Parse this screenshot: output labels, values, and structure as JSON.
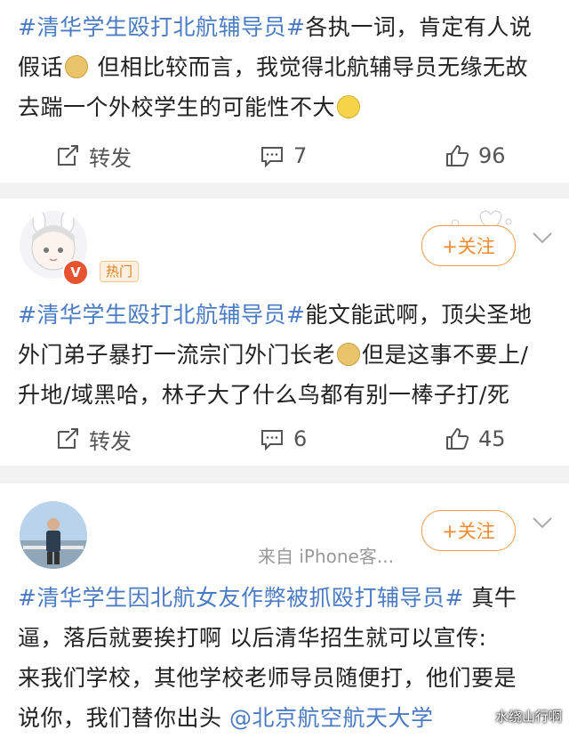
{
  "post1": {
    "hashtag": "#清华学生殴打北航辅导员#",
    "text_after_tag": "各执一词，肯定有人说",
    "line2_a": "假话",
    "line2_b": " 但相比较而言，我觉得北航辅导员无缘无故",
    "line3": "去踹一个外校学生的可能性不大",
    "repost_label": "转发",
    "comment_count": "7",
    "like_count": "96"
  },
  "post2": {
    "hot_badge": "热门",
    "verified_badge": "V",
    "follow_label": "+关注",
    "hashtag": "#清华学生殴打北航辅导员#",
    "text_after_tag": "能文能武啊，顶尖圣地",
    "line2_a": "外门弟子暴打一流宗门外门长老",
    "line2_b": "但是这事不要上/",
    "line3": "升地/域黑哈，林子大了什么鸟都有别一棒子打/死",
    "repost_label": "转发",
    "comment_count": "6",
    "like_count": "45"
  },
  "post3": {
    "follow_label": "+关注",
    "source": "来自 iPhone客...",
    "hashtag": "#清华学生因北航女友作弊被抓殴打辅导员#",
    "text_after_tag": " 真牛",
    "line2": "逼，落后就要挨打啊  以后清华招生就可以宣传:",
    "line3": "来我们学校，其他学校老师导员随便打，他们要是",
    "line4_a": "说你，我们替你出头 ",
    "mention": "@北京航空航天大学"
  },
  "watermark": "水绕山行啊",
  "colors": {
    "link": "#4b7bc3",
    "follow": "#f08a30",
    "separator": "#f2f2f2"
  },
  "icons": [
    "repost-icon",
    "comment-icon",
    "like-icon",
    "chevron-down-icon"
  ]
}
